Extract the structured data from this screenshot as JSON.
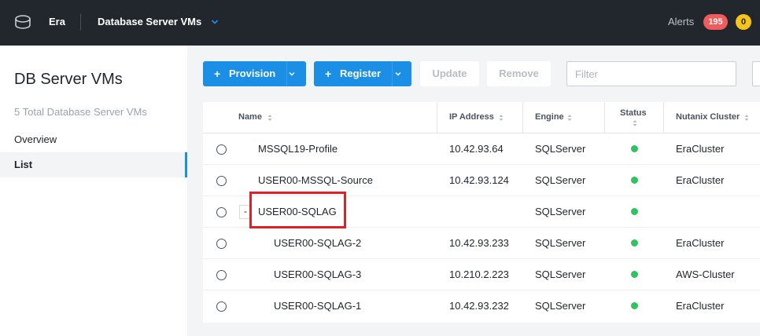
{
  "header": {
    "app_name": "Era",
    "breadcrumb": "Database Server VMs",
    "alerts_label": "Alerts",
    "alerts_count": "195",
    "warnings_count": "0",
    "colors": {
      "bar": "#22272e",
      "alert": "#f05b5b",
      "warning": "#f5c518"
    }
  },
  "sidebar": {
    "title": "DB Server VMs",
    "subtitle": "5 Total Database Server VMs",
    "items": [
      {
        "label": "Overview",
        "active": false
      },
      {
        "label": "List",
        "active": true
      }
    ]
  },
  "toolbar": {
    "provision_label": "Provision",
    "register_label": "Register",
    "update_label": "Update",
    "remove_label": "Remove",
    "filter_placeholder": "Filter",
    "accent": "#1b8ee5"
  },
  "table": {
    "columns": [
      "Name",
      "IP Address",
      "Engine",
      "Status",
      "Nutanix Cluster"
    ],
    "rows": [
      {
        "name": "MSSQL19-Profile",
        "ip": "10.42.93.64",
        "engine": "SQLServer",
        "status": "green",
        "cluster": "EraCluster"
      },
      {
        "name": "USER00-MSSQL-Source",
        "ip": "10.42.93.124",
        "engine": "SQLServer",
        "status": "green",
        "cluster": "EraCluster"
      },
      {
        "name": "USER00-SQLAG",
        "ip": "",
        "engine": "SQLServer",
        "status": "green",
        "cluster": "",
        "toggle": "-"
      },
      {
        "name": "USER00-SQLAG-2",
        "ip": "10.42.93.233",
        "engine": "SQLServer",
        "status": "green",
        "cluster": "EraCluster"
      },
      {
        "name": "USER00-SQLAG-3",
        "ip": "10.210.2.223",
        "engine": "SQLServer",
        "status": "green",
        "cluster": "AWS-Cluster"
      },
      {
        "name": "USER00-SQLAG-1",
        "ip": "10.42.93.232",
        "engine": "SQLServer",
        "status": "green",
        "cluster": "EraCluster"
      }
    ]
  }
}
